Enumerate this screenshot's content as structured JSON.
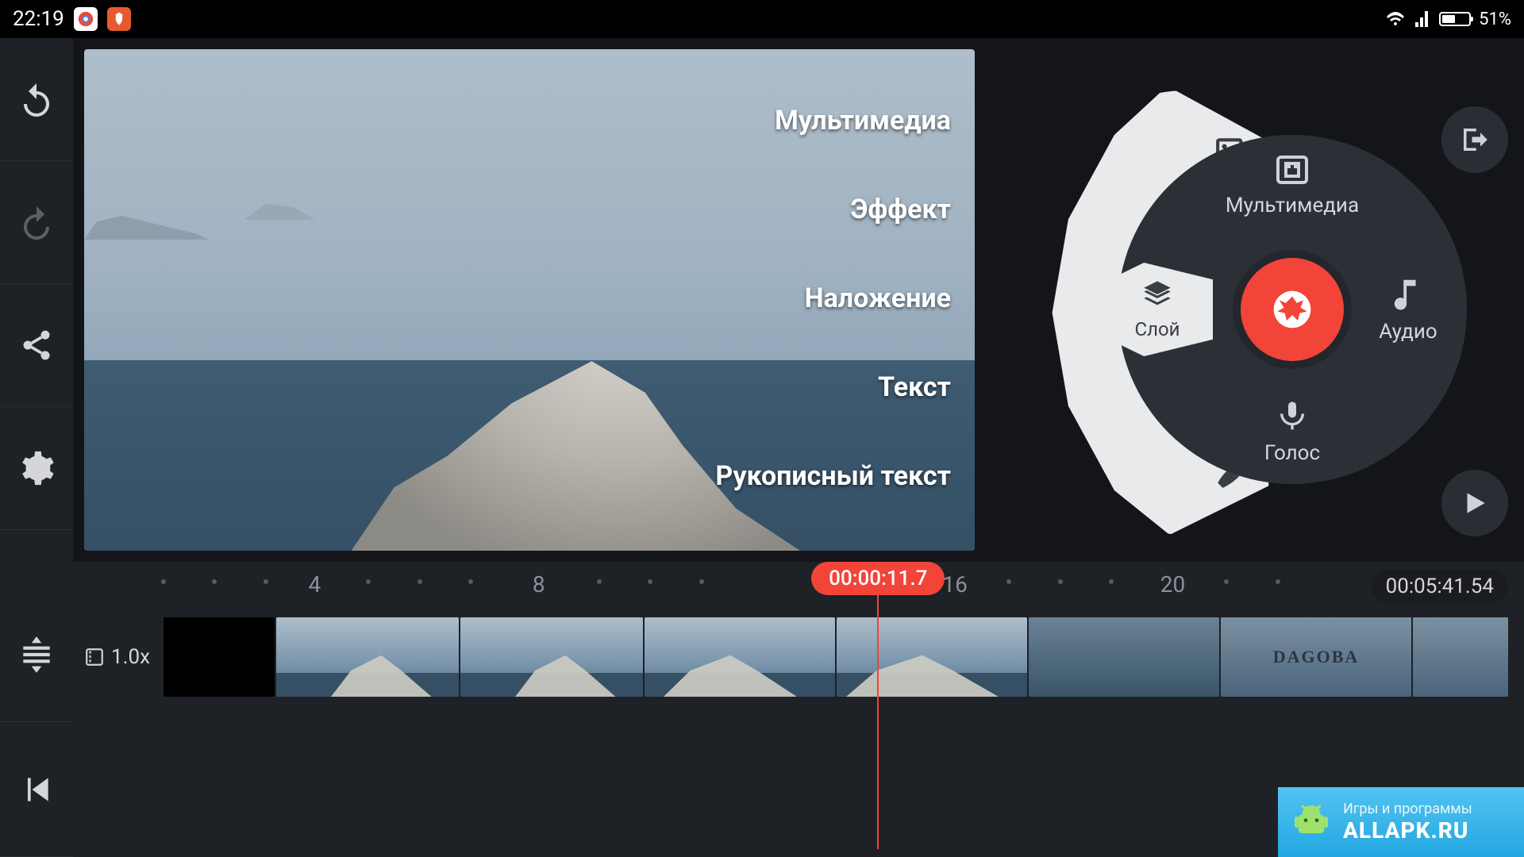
{
  "status": {
    "time": "22:19",
    "battery_pct": "51%"
  },
  "preview_labels": {
    "multimedia": "Мультимедиа",
    "effect": "Эффект",
    "overlay": "Наложение",
    "text": "Текст",
    "handwriting": "Рукописный текст"
  },
  "wheel": {
    "multimedia": "Мультимедиа",
    "layer": "Слой",
    "audio": "Аудио",
    "voice": "Голос"
  },
  "timeline": {
    "playhead_time": "00:00:11.7",
    "duration": "00:05:41.54",
    "speed": "1.0x",
    "marks": {
      "m4": "4",
      "m8": "8",
      "m16": "16",
      "m20": "20"
    },
    "title_clip": "DAGOBA"
  },
  "watermark": {
    "sub": "Игры и программы",
    "main": "ALLAPK.RU"
  }
}
